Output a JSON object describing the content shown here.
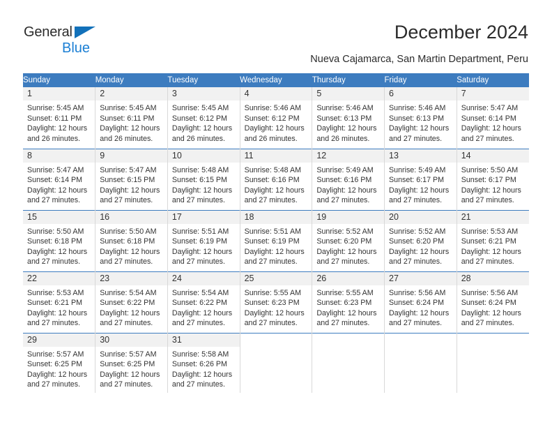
{
  "brand": {
    "name_part1": "General",
    "name_part2": "Blue",
    "accent_color": "#1b7fd4",
    "triangle_color": "#1271ba"
  },
  "header": {
    "title": "December 2024",
    "subtitle": "Nueva Cajamarca, San Martin Department, Peru"
  },
  "calendar": {
    "header_bg": "#3d7cbf",
    "daynum_bg": "#f1f1f1",
    "weekdays": [
      "Sunday",
      "Monday",
      "Tuesday",
      "Wednesday",
      "Thursday",
      "Friday",
      "Saturday"
    ],
    "weeks": [
      [
        {
          "day": "1",
          "sunrise": "Sunrise: 5:45 AM",
          "sunset": "Sunset: 6:11 PM",
          "daylight1": "Daylight: 12 hours",
          "daylight2": "and 26 minutes."
        },
        {
          "day": "2",
          "sunrise": "Sunrise: 5:45 AM",
          "sunset": "Sunset: 6:11 PM",
          "daylight1": "Daylight: 12 hours",
          "daylight2": "and 26 minutes."
        },
        {
          "day": "3",
          "sunrise": "Sunrise: 5:45 AM",
          "sunset": "Sunset: 6:12 PM",
          "daylight1": "Daylight: 12 hours",
          "daylight2": "and 26 minutes."
        },
        {
          "day": "4",
          "sunrise": "Sunrise: 5:46 AM",
          "sunset": "Sunset: 6:12 PM",
          "daylight1": "Daylight: 12 hours",
          "daylight2": "and 26 minutes."
        },
        {
          "day": "5",
          "sunrise": "Sunrise: 5:46 AM",
          "sunset": "Sunset: 6:13 PM",
          "daylight1": "Daylight: 12 hours",
          "daylight2": "and 26 minutes."
        },
        {
          "day": "6",
          "sunrise": "Sunrise: 5:46 AM",
          "sunset": "Sunset: 6:13 PM",
          "daylight1": "Daylight: 12 hours",
          "daylight2": "and 27 minutes."
        },
        {
          "day": "7",
          "sunrise": "Sunrise: 5:47 AM",
          "sunset": "Sunset: 6:14 PM",
          "daylight1": "Daylight: 12 hours",
          "daylight2": "and 27 minutes."
        }
      ],
      [
        {
          "day": "8",
          "sunrise": "Sunrise: 5:47 AM",
          "sunset": "Sunset: 6:14 PM",
          "daylight1": "Daylight: 12 hours",
          "daylight2": "and 27 minutes."
        },
        {
          "day": "9",
          "sunrise": "Sunrise: 5:47 AM",
          "sunset": "Sunset: 6:15 PM",
          "daylight1": "Daylight: 12 hours",
          "daylight2": "and 27 minutes."
        },
        {
          "day": "10",
          "sunrise": "Sunrise: 5:48 AM",
          "sunset": "Sunset: 6:15 PM",
          "daylight1": "Daylight: 12 hours",
          "daylight2": "and 27 minutes."
        },
        {
          "day": "11",
          "sunrise": "Sunrise: 5:48 AM",
          "sunset": "Sunset: 6:16 PM",
          "daylight1": "Daylight: 12 hours",
          "daylight2": "and 27 minutes."
        },
        {
          "day": "12",
          "sunrise": "Sunrise: 5:49 AM",
          "sunset": "Sunset: 6:16 PM",
          "daylight1": "Daylight: 12 hours",
          "daylight2": "and 27 minutes."
        },
        {
          "day": "13",
          "sunrise": "Sunrise: 5:49 AM",
          "sunset": "Sunset: 6:17 PM",
          "daylight1": "Daylight: 12 hours",
          "daylight2": "and 27 minutes."
        },
        {
          "day": "14",
          "sunrise": "Sunrise: 5:50 AM",
          "sunset": "Sunset: 6:17 PM",
          "daylight1": "Daylight: 12 hours",
          "daylight2": "and 27 minutes."
        }
      ],
      [
        {
          "day": "15",
          "sunrise": "Sunrise: 5:50 AM",
          "sunset": "Sunset: 6:18 PM",
          "daylight1": "Daylight: 12 hours",
          "daylight2": "and 27 minutes."
        },
        {
          "day": "16",
          "sunrise": "Sunrise: 5:50 AM",
          "sunset": "Sunset: 6:18 PM",
          "daylight1": "Daylight: 12 hours",
          "daylight2": "and 27 minutes."
        },
        {
          "day": "17",
          "sunrise": "Sunrise: 5:51 AM",
          "sunset": "Sunset: 6:19 PM",
          "daylight1": "Daylight: 12 hours",
          "daylight2": "and 27 minutes."
        },
        {
          "day": "18",
          "sunrise": "Sunrise: 5:51 AM",
          "sunset": "Sunset: 6:19 PM",
          "daylight1": "Daylight: 12 hours",
          "daylight2": "and 27 minutes."
        },
        {
          "day": "19",
          "sunrise": "Sunrise: 5:52 AM",
          "sunset": "Sunset: 6:20 PM",
          "daylight1": "Daylight: 12 hours",
          "daylight2": "and 27 minutes."
        },
        {
          "day": "20",
          "sunrise": "Sunrise: 5:52 AM",
          "sunset": "Sunset: 6:20 PM",
          "daylight1": "Daylight: 12 hours",
          "daylight2": "and 27 minutes."
        },
        {
          "day": "21",
          "sunrise": "Sunrise: 5:53 AM",
          "sunset": "Sunset: 6:21 PM",
          "daylight1": "Daylight: 12 hours",
          "daylight2": "and 27 minutes."
        }
      ],
      [
        {
          "day": "22",
          "sunrise": "Sunrise: 5:53 AM",
          "sunset": "Sunset: 6:21 PM",
          "daylight1": "Daylight: 12 hours",
          "daylight2": "and 27 minutes."
        },
        {
          "day": "23",
          "sunrise": "Sunrise: 5:54 AM",
          "sunset": "Sunset: 6:22 PM",
          "daylight1": "Daylight: 12 hours",
          "daylight2": "and 27 minutes."
        },
        {
          "day": "24",
          "sunrise": "Sunrise: 5:54 AM",
          "sunset": "Sunset: 6:22 PM",
          "daylight1": "Daylight: 12 hours",
          "daylight2": "and 27 minutes."
        },
        {
          "day": "25",
          "sunrise": "Sunrise: 5:55 AM",
          "sunset": "Sunset: 6:23 PM",
          "daylight1": "Daylight: 12 hours",
          "daylight2": "and 27 minutes."
        },
        {
          "day": "26",
          "sunrise": "Sunrise: 5:55 AM",
          "sunset": "Sunset: 6:23 PM",
          "daylight1": "Daylight: 12 hours",
          "daylight2": "and 27 minutes."
        },
        {
          "day": "27",
          "sunrise": "Sunrise: 5:56 AM",
          "sunset": "Sunset: 6:24 PM",
          "daylight1": "Daylight: 12 hours",
          "daylight2": "and 27 minutes."
        },
        {
          "day": "28",
          "sunrise": "Sunrise: 5:56 AM",
          "sunset": "Sunset: 6:24 PM",
          "daylight1": "Daylight: 12 hours",
          "daylight2": "and 27 minutes."
        }
      ],
      [
        {
          "day": "29",
          "sunrise": "Sunrise: 5:57 AM",
          "sunset": "Sunset: 6:25 PM",
          "daylight1": "Daylight: 12 hours",
          "daylight2": "and 27 minutes."
        },
        {
          "day": "30",
          "sunrise": "Sunrise: 5:57 AM",
          "sunset": "Sunset: 6:25 PM",
          "daylight1": "Daylight: 12 hours",
          "daylight2": "and 27 minutes."
        },
        {
          "day": "31",
          "sunrise": "Sunrise: 5:58 AM",
          "sunset": "Sunset: 6:26 PM",
          "daylight1": "Daylight: 12 hours",
          "daylight2": "and 27 minutes."
        },
        {
          "day": "",
          "sunrise": "",
          "sunset": "",
          "daylight1": "",
          "daylight2": ""
        },
        {
          "day": "",
          "sunrise": "",
          "sunset": "",
          "daylight1": "",
          "daylight2": ""
        },
        {
          "day": "",
          "sunrise": "",
          "sunset": "",
          "daylight1": "",
          "daylight2": ""
        },
        {
          "day": "",
          "sunrise": "",
          "sunset": "",
          "daylight1": "",
          "daylight2": ""
        }
      ]
    ]
  }
}
